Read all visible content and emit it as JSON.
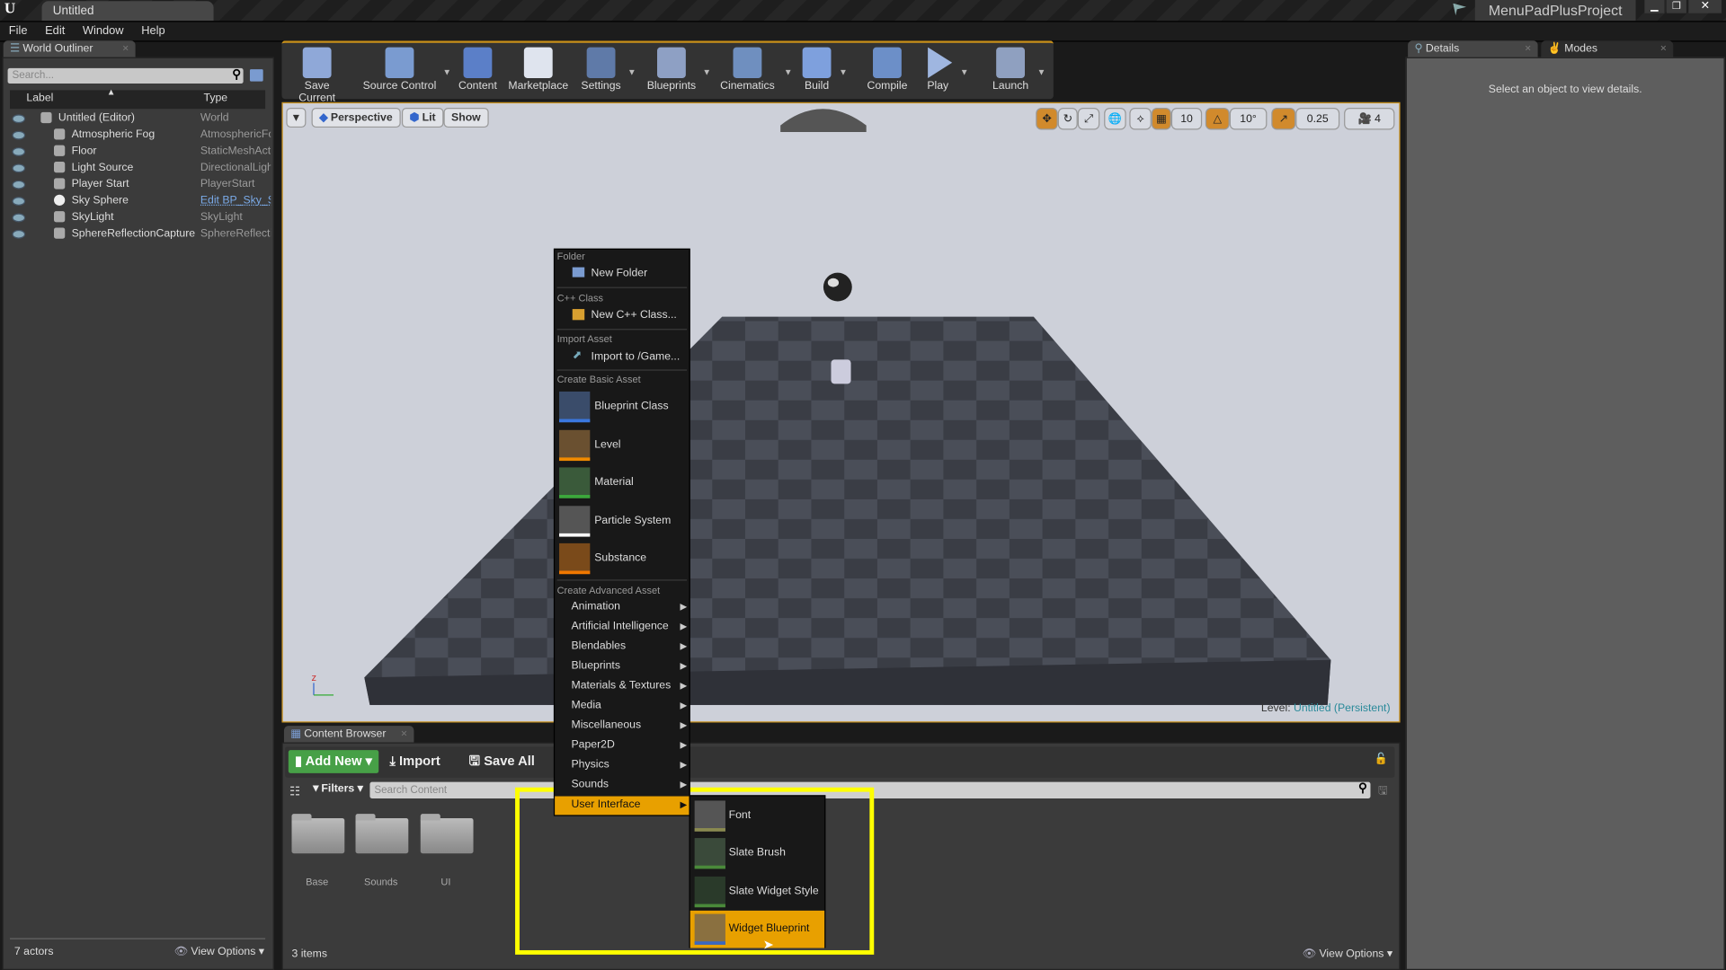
{
  "titlebar": {
    "doc_tab": "Untitled",
    "project": "MenuPadPlusProject"
  },
  "menubar": [
    "File",
    "Edit",
    "Window",
    "Help"
  ],
  "outliner": {
    "tab": "World Outliner",
    "search_placeholder": "Search...",
    "col_label": "Label",
    "col_type": "Type",
    "rows": [
      {
        "label": "Untitled (Editor)",
        "type": "World"
      },
      {
        "label": "Atmospheric Fog",
        "type": "AtmosphericFog"
      },
      {
        "label": "Floor",
        "type": "StaticMeshActor"
      },
      {
        "label": "Light Source",
        "type": "DirectionalLight"
      },
      {
        "label": "Player Start",
        "type": "PlayerStart"
      },
      {
        "label": "Sky Sphere",
        "type": "Edit BP_Sky_Sphere"
      },
      {
        "label": "SkyLight",
        "type": "SkyLight"
      },
      {
        "label": "SphereReflectionCapture",
        "type": "SphereReflectionCapture"
      }
    ],
    "footer_count": "7 actors",
    "view_options": "View Options"
  },
  "toolbar": [
    {
      "label": "Save Current",
      "icon": "save-icon",
      "color": "#8fa8d8",
      "dropdown": false
    },
    {
      "label": "Source Control",
      "icon": "source-control-icon",
      "color": "#7a9bd0",
      "dropdown": true
    },
    {
      "label": "Content",
      "icon": "content-icon",
      "color": "#5b7fc8",
      "dropdown": false
    },
    {
      "label": "Marketplace",
      "icon": "marketplace-icon",
      "color": "#dfe4ee",
      "dropdown": false
    },
    {
      "label": "Settings",
      "icon": "settings-icon",
      "color": "#5f7aa8",
      "dropdown": true
    },
    {
      "label": "Blueprints",
      "icon": "blueprints-icon",
      "color": "#8ea0c4",
      "dropdown": true
    },
    {
      "label": "Cinematics",
      "icon": "cinematics-icon",
      "color": "#6f8fbf",
      "dropdown": true
    },
    {
      "label": "Build",
      "icon": "build-icon",
      "color": "#7ea0dd",
      "dropdown": true
    },
    {
      "label": "Compile",
      "icon": "compile-icon",
      "color": "#6c8fc8",
      "dropdown": false
    },
    {
      "label": "Play",
      "icon": "play-icon",
      "color": "#9fb6e0",
      "dropdown": true
    },
    {
      "label": "Launch",
      "icon": "launch-icon",
      "color": "#8fa0c0",
      "dropdown": true
    }
  ],
  "viewport": {
    "perspective": "Perspective",
    "lit": "Lit",
    "show": "Show",
    "grid_snap": "10",
    "rot_snap": "10°",
    "scale_snap": "0.25",
    "cam_speed": "4",
    "level_label": "Level:",
    "level_name": "Untitled (Persistent)"
  },
  "details": {
    "tab_details": "Details",
    "tab_modes": "Modes",
    "empty": "Select an object to view details."
  },
  "content_browser": {
    "tab": "Content Browser",
    "add_new": "Add New",
    "import": "Import",
    "save_all": "Save All",
    "filters": "Filters",
    "search_placeholder": "Search Content",
    "folders": [
      "Base",
      "Sounds",
      "UI"
    ],
    "count": "3 items",
    "view_options": "View Options"
  },
  "context_menu": {
    "sections": {
      "folder": "Folder",
      "cpp": "C++ Class",
      "import": "Import Asset",
      "basic": "Create Basic Asset",
      "advanced": "Create Advanced Asset"
    },
    "new_folder": "New Folder",
    "new_cpp": "New C++ Class...",
    "import_to": "Import to /Game...",
    "basic": [
      {
        "label": "Blueprint Class",
        "color": "#3a78e0",
        "bg": "#3a4c6a"
      },
      {
        "label": "Level",
        "color": "#f08a00",
        "bg": "#6a5030"
      },
      {
        "label": "Material",
        "color": "#3ca83c",
        "bg": "#3a5a3a"
      },
      {
        "label": "Particle System",
        "color": "#ffffff",
        "bg": "#555"
      },
      {
        "label": "Substance",
        "color": "#f07800",
        "bg": "#7a4a1a"
      }
    ],
    "advanced": [
      "Animation",
      "Artificial Intelligence",
      "Blendables",
      "Blueprints",
      "Materials & Textures",
      "Media",
      "Miscellaneous",
      "Paper2D",
      "Physics",
      "Sounds",
      "User Interface"
    ],
    "selected": "User Interface",
    "submenu": [
      {
        "label": "Font",
        "color": "#8a8a50",
        "bg": "#555"
      },
      {
        "label": "Slate Brush",
        "color": "#4a8a3a",
        "bg": "#3a4a3a"
      },
      {
        "label": "Slate Widget Style",
        "color": "#4a8a3a",
        "bg": "#2a3a2a"
      },
      {
        "label": "Widget Blueprint",
        "color": "#3a68c0",
        "bg": "#8a7040"
      }
    ],
    "submenu_selected": "Widget Blueprint",
    "highlight_color": "#e8a000",
    "annotation_color": "#ffff00"
  }
}
